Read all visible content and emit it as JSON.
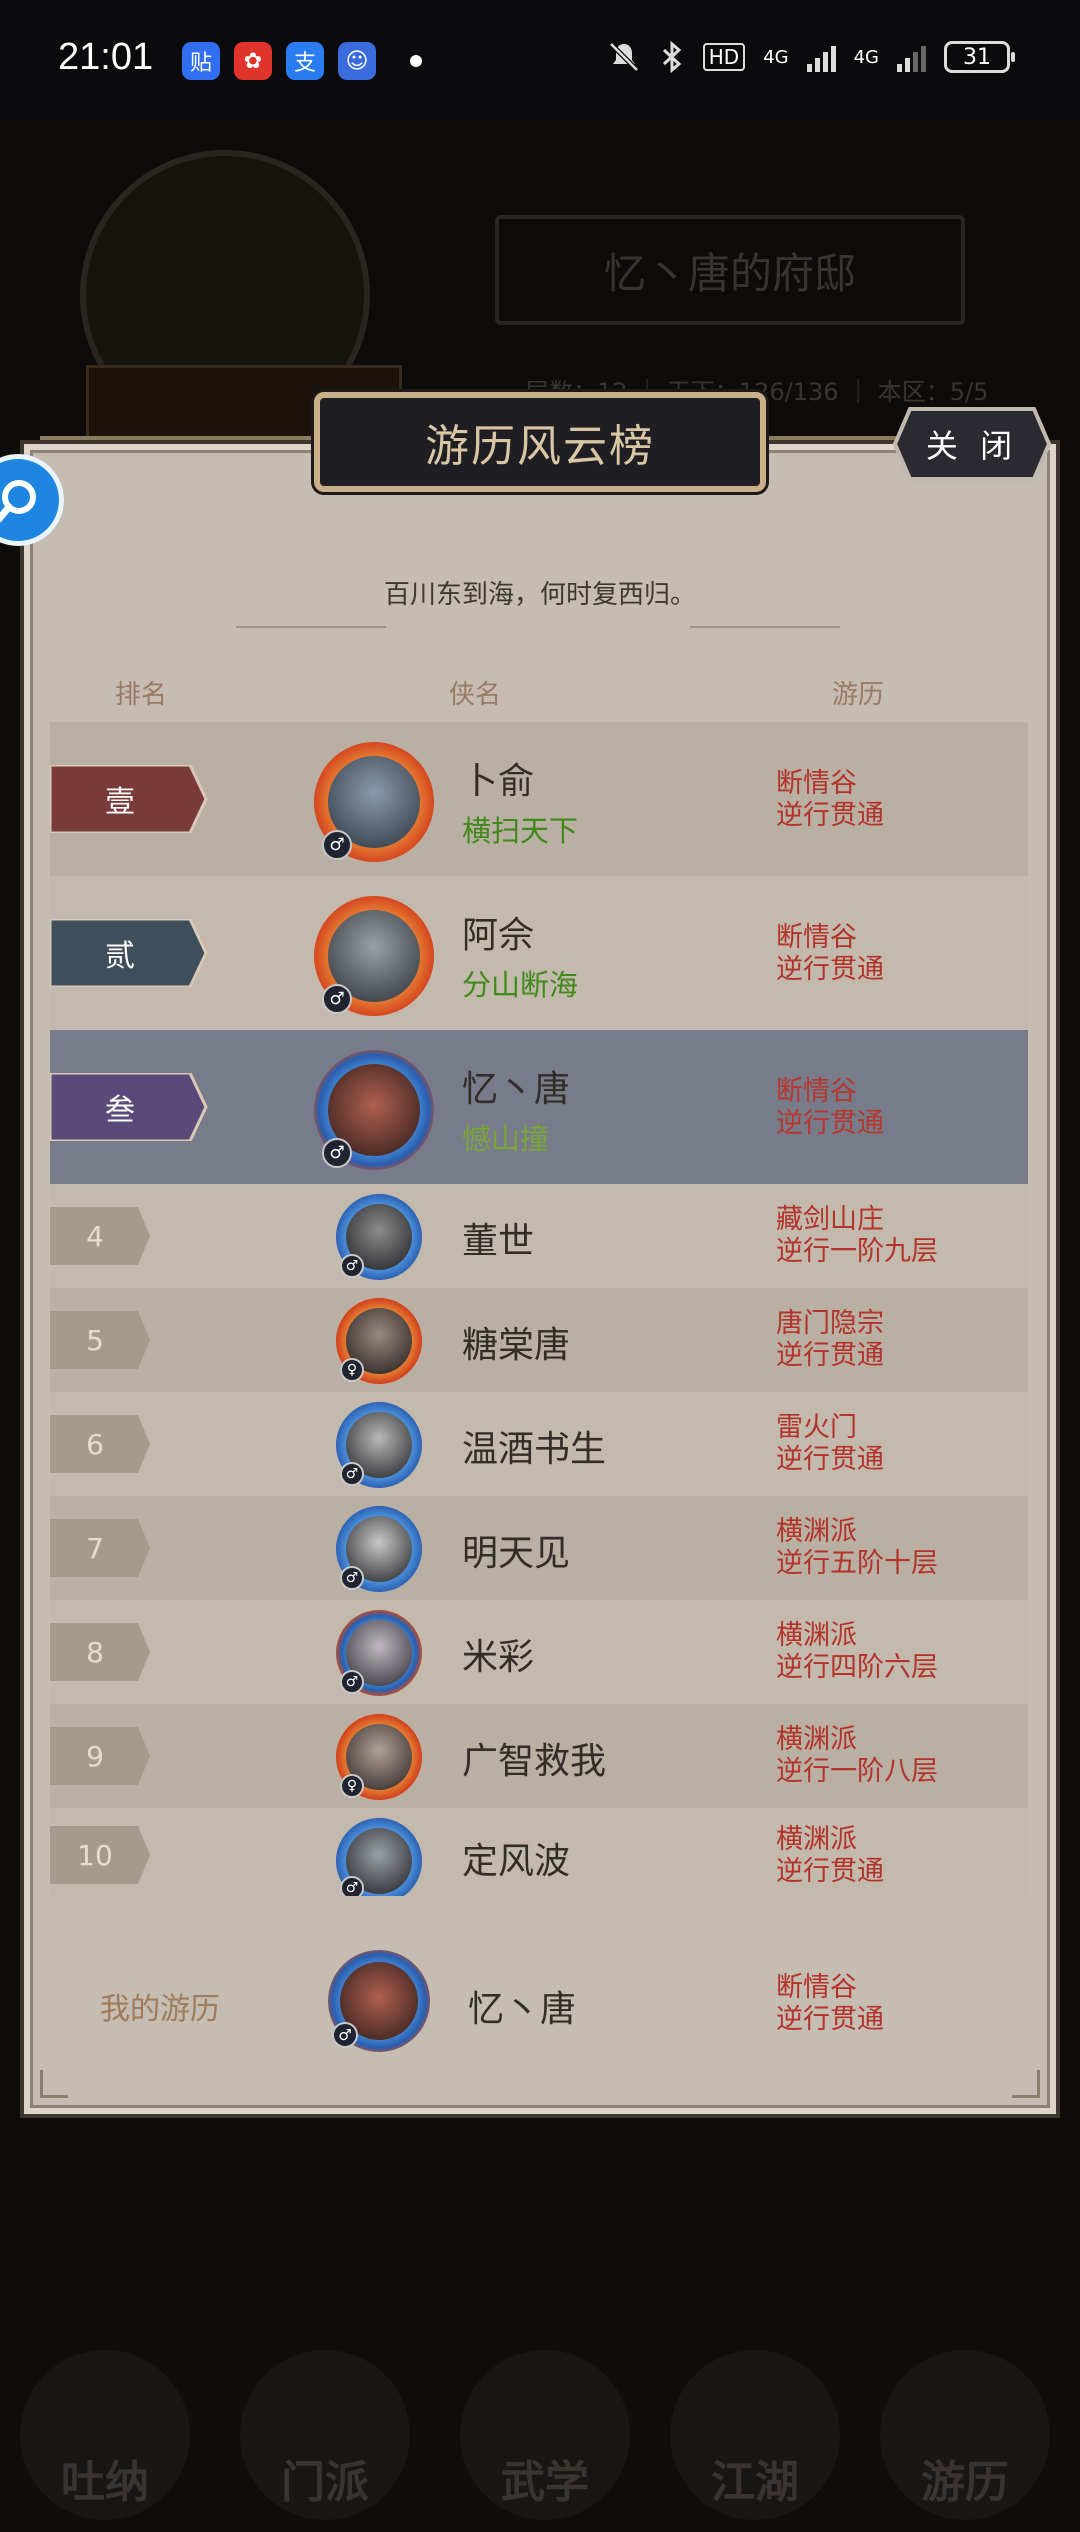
{
  "status_bar": {
    "time": "21:01",
    "app_icons": [
      {
        "icon": "tieba-icon",
        "glyph": "贴",
        "color": "#2f6ff0"
      },
      {
        "icon": "xiaohongshu-icon",
        "glyph": "✿",
        "color": "#e0332b"
      },
      {
        "icon": "alipay-icon",
        "glyph": "支",
        "color": "#2a7df0"
      },
      {
        "icon": "game-app-icon",
        "glyph": "☺",
        "color": "#3b6cde"
      }
    ],
    "hd_badge": "HD",
    "network_1": "4G",
    "network_2": "4G",
    "battery": "31"
  },
  "background": {
    "residence_title": "忆丶唐的府邸",
    "stats_line": "层数：12 ｜ 天下：126/136 ｜ 本区：5/5",
    "nav": [
      "吐纳",
      "门派",
      "武学",
      "江湖",
      "游历"
    ]
  },
  "panel": {
    "title": "游历风云榜",
    "close_label": "关 闭",
    "subtitle": "百川东到海，何时复西归。",
    "columns": {
      "rank": "排名",
      "name": "侠名",
      "travel": "游历"
    }
  },
  "rows": [
    {
      "rank": "壹",
      "name": "卜俞",
      "title": "横扫天下",
      "sect": "断情谷",
      "progress": "逆行贯通",
      "gender": "♂"
    },
    {
      "rank": "贰",
      "name": "阿佘",
      "title": "分山断海",
      "sect": "断情谷",
      "progress": "逆行贯通",
      "gender": "♂"
    },
    {
      "rank": "叁",
      "name": "忆丶唐",
      "title": "憾山撞",
      "sect": "断情谷",
      "progress": "逆行贯通",
      "gender": "♂"
    },
    {
      "rank": "4",
      "name": "董世",
      "sect": "藏剑山庄",
      "progress": "逆行一阶九层",
      "gender": "♂"
    },
    {
      "rank": "5",
      "name": "糖棠唐",
      "sect": "唐门隐宗",
      "progress": "逆行贯通",
      "gender": "♀"
    },
    {
      "rank": "6",
      "name": "温酒书生",
      "sect": "雷火门",
      "progress": "逆行贯通",
      "gender": "♂"
    },
    {
      "rank": "7",
      "name": "明天见",
      "sect": "横渊派",
      "progress": "逆行五阶十层",
      "gender": "♂"
    },
    {
      "rank": "8",
      "name": "米彩",
      "sect": "横渊派",
      "progress": "逆行四阶六层",
      "gender": "♂"
    },
    {
      "rank": "9",
      "name": "广智救我",
      "sect": "横渊派",
      "progress": "逆行一阶八层",
      "gender": "♀"
    },
    {
      "rank": "10",
      "name": "定风波",
      "sect": "横渊派",
      "progress": "逆行贯通",
      "gender": "♂"
    }
  ],
  "my_travel": {
    "label": "我的游历",
    "name": "忆丶唐",
    "sect": "断情谷",
    "progress": "逆行贯通",
    "gender": "♂"
  },
  "colors": {
    "rank1_banner": "#7a3a3a",
    "rank2_banner": "#3f4e5b",
    "rank3_banner": "#5a4a7a",
    "highlight_row": "#777b8a",
    "title_green": "#3f8a1a",
    "travel_red": "#b3332a"
  }
}
